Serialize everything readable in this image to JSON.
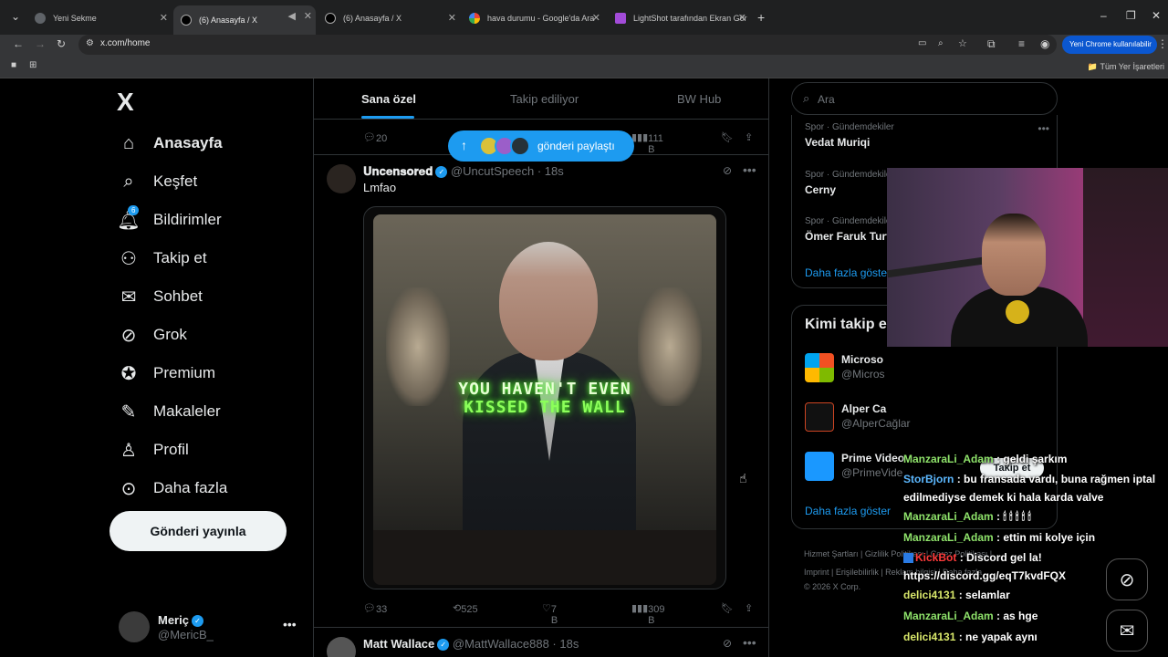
{
  "browser": {
    "tabs": [
      {
        "title": "Yeni Sekme"
      },
      {
        "title": "(6) Anasayfa / X"
      },
      {
        "title": "(6) Anasayfa / X"
      },
      {
        "title": "hava durumu - Google'da Ara"
      },
      {
        "title": "LightShot tarafından Ekran Gör"
      }
    ],
    "url": "x.com/home",
    "chrome_pill": "Yeni Chrome kullanılabilir",
    "all_bookmarks": "Tüm Yer İşaretleri"
  },
  "sidebar": {
    "logo": "X",
    "items": [
      {
        "label": "Anasayfa"
      },
      {
        "label": "Keşfet"
      },
      {
        "label": "Bildirimler",
        "badge": "6"
      },
      {
        "label": "Takip et"
      },
      {
        "label": "Sohbet"
      },
      {
        "label": "Grok"
      },
      {
        "label": "Premium"
      },
      {
        "label": "Makaleler"
      },
      {
        "label": "Profil"
      },
      {
        "label": "Daha fazla"
      }
    ],
    "post_button": "Gönderi yayınla",
    "user": {
      "name": "Meriç",
      "handle": "@MericB_"
    }
  },
  "feed": {
    "tabs": [
      "Sana özel",
      "Takip ediliyor",
      "BW Hub"
    ],
    "top_actions": {
      "replies": "20",
      "views": "111 B"
    },
    "share_pill": "gönderi paylaştı",
    "tweet1": {
      "author": "𝐔𝐧𝐜𝐞𝐧𝐬𝐨𝐫𝐞𝐝",
      "handle": "@UncutSpeech · 18s",
      "text": "Lmfao",
      "image_text_1": "YOU HAVEN'T EVEN",
      "image_text_2": "KISSED THE WALL",
      "replies": "33",
      "reposts": "525",
      "likes": "7 B",
      "views": "309 B"
    },
    "tweet2": {
      "author": "Matt Wallace",
      "handle": "@MattWallace888 · 18s"
    }
  },
  "right": {
    "search_placeholder": "Ara",
    "trends": [
      {
        "category": "Spor · Gündemdekiler",
        "title": "Vedat Muriqi"
      },
      {
        "category": "Spor · Gündemdekiler",
        "title": "Cerny"
      },
      {
        "category": "Spor · Gündemdekiler",
        "title": "Ömer Faruk Turtay"
      }
    ],
    "trends_more": "Daha fazla göster",
    "who_title": "Kimi takip e",
    "who": [
      {
        "name": "Microso",
        "handle": "@Micros"
      },
      {
        "name": "Alper Ca",
        "handle": "@AlperCağlar"
      },
      {
        "name": "Prime Video",
        "handle": "@PrimeVide"
      }
    ],
    "who_more": "Daha fazla göster",
    "footer_1": "Hizmet Şartları  |  Gizlilik Politikası  |  Çerez Politikası  |",
    "footer_2": "Imprint  |  Erişilebilirlik  |  Reklam bilgisi  |  Daha fazla ...",
    "footer_3": "© 2026 X Corp."
  },
  "chat": {
    "follow_button": "Takip et",
    "messages": [
      {
        "user": "ManzaraLi_Adam",
        "text": ": geldi şarkım"
      },
      {
        "user": "StorBjorn",
        "text": ": bu fransada vardı, buna rağmen iptal edilmediyse demek ki hala karda valve"
      },
      {
        "user": "ManzaraLi_Adam",
        "text": ": 🕯 🕯 🕯 🕯 🕯"
      },
      {
        "user": "ManzaraLi_Adam",
        "text": ": ettin mi kolye için"
      },
      {
        "user": "KickBot",
        "text": ": Discord gel la! https://discord.gg/eqT7kvdFQX"
      },
      {
        "user": "delici4131",
        "text": ": selamlar"
      },
      {
        "user": "ManzaraLi_Adam",
        "text": ": as hge"
      },
      {
        "user": "delici4131",
        "text": ": ne yapak aynı"
      }
    ]
  }
}
